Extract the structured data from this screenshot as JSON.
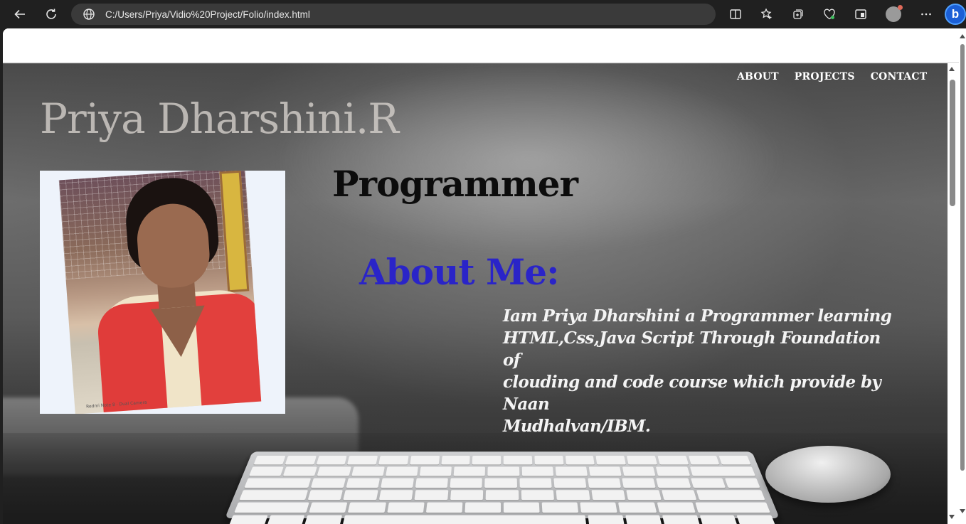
{
  "browser": {
    "url": "C:/Users/Priya/Vidio%20Project/Folio/index.html",
    "accent_color": "#1b5fd6",
    "toolbar_icons": [
      "back-icon",
      "refresh-icon",
      "site-info-icon",
      "split-screen-icon",
      "favorites-icon",
      "collections-icon",
      "browser-essentials-icon",
      "workspaces-icon",
      "profile-icon",
      "more-icon",
      "copilot-icon"
    ],
    "copilot_label": "b"
  },
  "page": {
    "nav": [
      "ABOUT",
      "PROJECTS",
      "CONTACT"
    ],
    "title": "Priya Dharshini.R",
    "role": "Programmer",
    "about_heading": "About Me:",
    "about_text": "Iam Priya Dharshini  a Programmer  learning\nHTML,Css,Java Script Through Foundation of\nclouding and code course which provide by Naan\nMudhalvan/IBM.",
    "heading_color": "#2a24c8",
    "photo_caption": "Redmi Note 8 · Dual Camera"
  }
}
